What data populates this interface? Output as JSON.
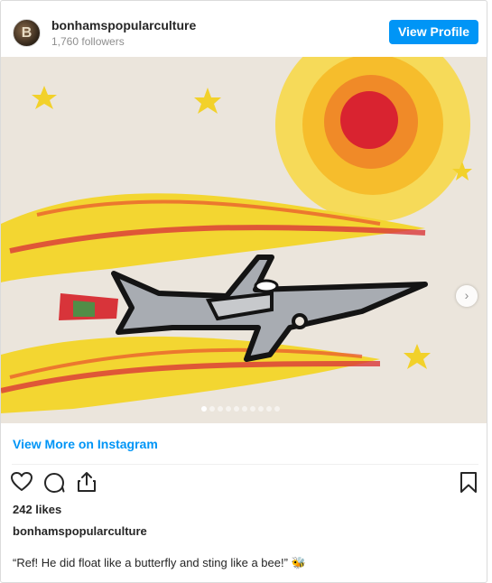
{
  "header": {
    "avatar_letter": "B",
    "username": "bonhamspopularculture",
    "followers": "1,760 followers",
    "view_profile_label": "View Profile"
  },
  "media": {
    "slide_count": 10,
    "active_slide": 1
  },
  "more_link": "View More on Instagram",
  "actions": {
    "icons": [
      "heart-icon",
      "comment-icon",
      "share-icon",
      "bookmark-icon"
    ]
  },
  "likes": "242 likes",
  "author": "bonhamspopularculture",
  "caption": "“Ref! He did float like a butterfly and sting like a bee!” 🐝",
  "colors": {
    "accent": "#0095f6",
    "text": "#262626",
    "muted": "#8e8e8e",
    "border": "#dbdbdb"
  }
}
